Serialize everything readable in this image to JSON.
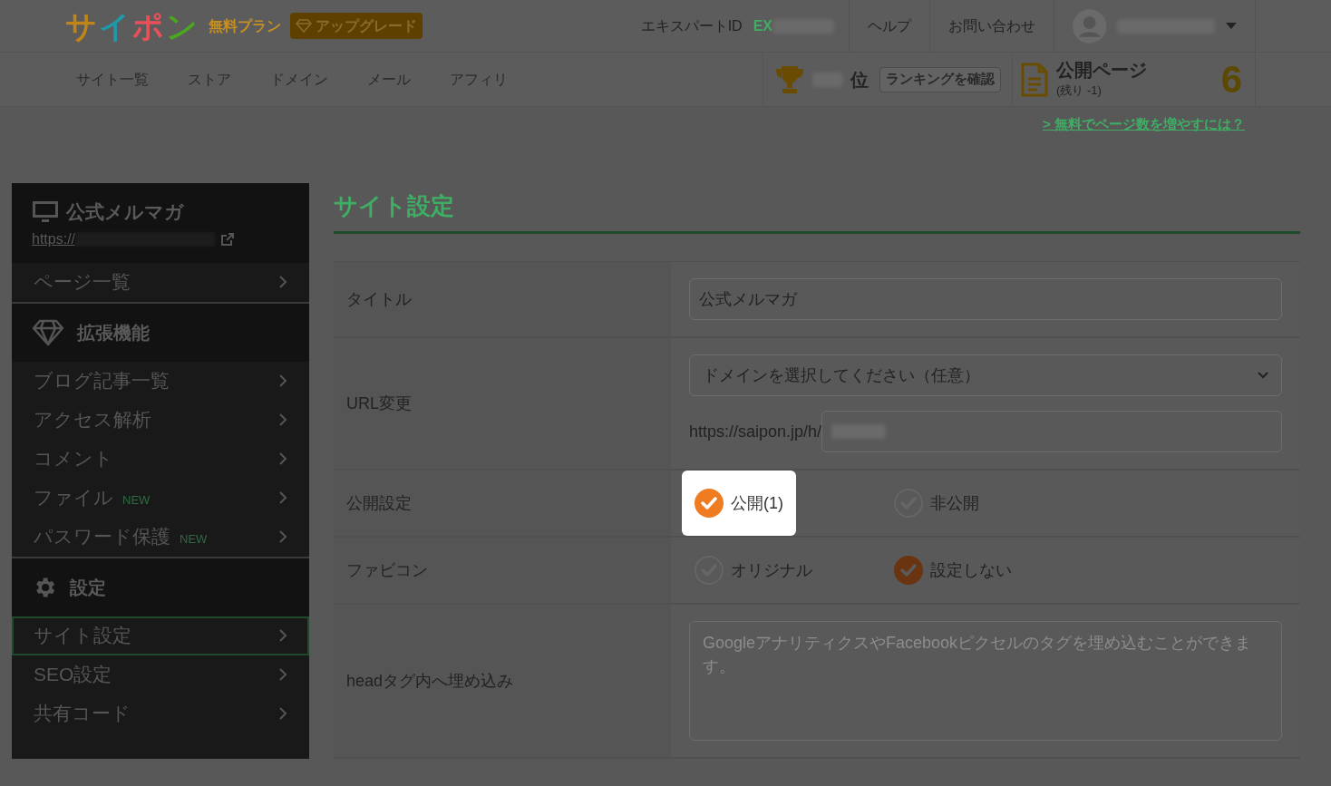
{
  "header": {
    "logo": [
      {
        "char": "サ",
        "color": "#c08418"
      },
      {
        "char": "イ",
        "color": "#1f98aa"
      },
      {
        "char": "ポ",
        "color": "#e8505a"
      },
      {
        "char": "ン",
        "color": "#4aa81e"
      }
    ],
    "plan": "無料プラン",
    "upgrade_button": "アップグレード",
    "expert_id_label": "エキスパートID",
    "expert_id_prefix": "EX",
    "links": [
      "ヘルプ",
      "お問い合わせ"
    ]
  },
  "nav": {
    "items": [
      "サイト一覧",
      "ストア",
      "ドメイン",
      "メール",
      "アフィリ"
    ],
    "ranking": {
      "suffix": "位",
      "button": "ランキングを確認"
    },
    "public_pages": {
      "title": "公開ページ",
      "remaining": "(残り -1)",
      "count": "6"
    },
    "more_link": "> 無料でページ数を増やすには？"
  },
  "sidebar": {
    "site": {
      "title": "公式メルマガ",
      "url": "https://"
    },
    "sections": [
      {
        "items": [
          {
            "label": "ページ一覧",
            "selected": false
          }
        ]
      },
      {
        "heading": "拡張機能",
        "items": [
          {
            "label": "ブログ記事一覧",
            "selected": false
          },
          {
            "label": "アクセス解析",
            "selected": false
          },
          {
            "label": "コメント",
            "selected": false
          },
          {
            "label": "ファイル",
            "selected": false,
            "badge": "NEW"
          },
          {
            "label": "パスワード保護",
            "selected": false,
            "badge": "NEW"
          }
        ]
      },
      {
        "heading": "設定",
        "items": [
          {
            "label": "サイト設定",
            "selected": true
          },
          {
            "label": "SEO設定",
            "selected": false
          },
          {
            "label": "共有コード",
            "selected": false
          }
        ]
      }
    ]
  },
  "content": {
    "title": "サイト設定",
    "rows": [
      {
        "kind": "text",
        "label": "タイトル",
        "value": "公式メルマガ"
      },
      {
        "kind": "url",
        "label": "URL変更",
        "select": "ドメインを選択してください（任意）",
        "prefix": "https://saipon.jp/h/"
      },
      {
        "kind": "radio",
        "label": "公開設定",
        "options": [
          {
            "label": "公開(1)",
            "selected": true,
            "spotlight": true
          },
          {
            "label": "非公開",
            "selected": false,
            "spotlight": false
          }
        ]
      },
      {
        "kind": "radio",
        "label": "ファビコン",
        "options": [
          {
            "label": "オリジナル",
            "selected": false,
            "spotlight": false
          },
          {
            "label": "設定しない",
            "selected": true,
            "spotlight": false
          }
        ]
      },
      {
        "kind": "textarea",
        "label": "headタグ内へ埋め込み",
        "placeholder": "GoogleアナリティクスやFacebookピクセルのタグを埋め込むことができます。"
      }
    ]
  }
}
